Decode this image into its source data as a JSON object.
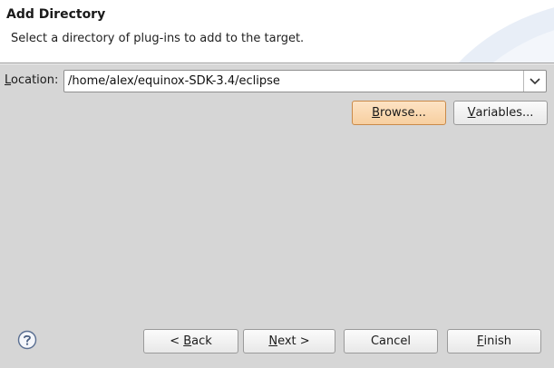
{
  "header": {
    "title": "Add Directory",
    "description": "Select a directory of plug-ins to add to the target."
  },
  "location": {
    "label_mnemonic": "L",
    "label_rest": "ocation:",
    "value": "/home/alex/equinox-SDK-3.4/eclipse"
  },
  "buttons": {
    "browse": {
      "mnemonic": "B",
      "rest": "rowse..."
    },
    "variables": {
      "mnemonic": "V",
      "rest": "ariables..."
    },
    "back": {
      "prefix": "< ",
      "mnemonic": "B",
      "rest": "ack"
    },
    "next": {
      "mnemonic": "N",
      "rest": "ext >"
    },
    "cancel": {
      "label": "Cancel"
    },
    "finish": {
      "mnemonic": "F",
      "rest": "inish"
    }
  },
  "icons": {
    "help": "help-icon",
    "dropdown": "chevron-down-icon"
  },
  "colors": {
    "hover_button": "#f7cfa0",
    "background": "#d6d6d6"
  }
}
